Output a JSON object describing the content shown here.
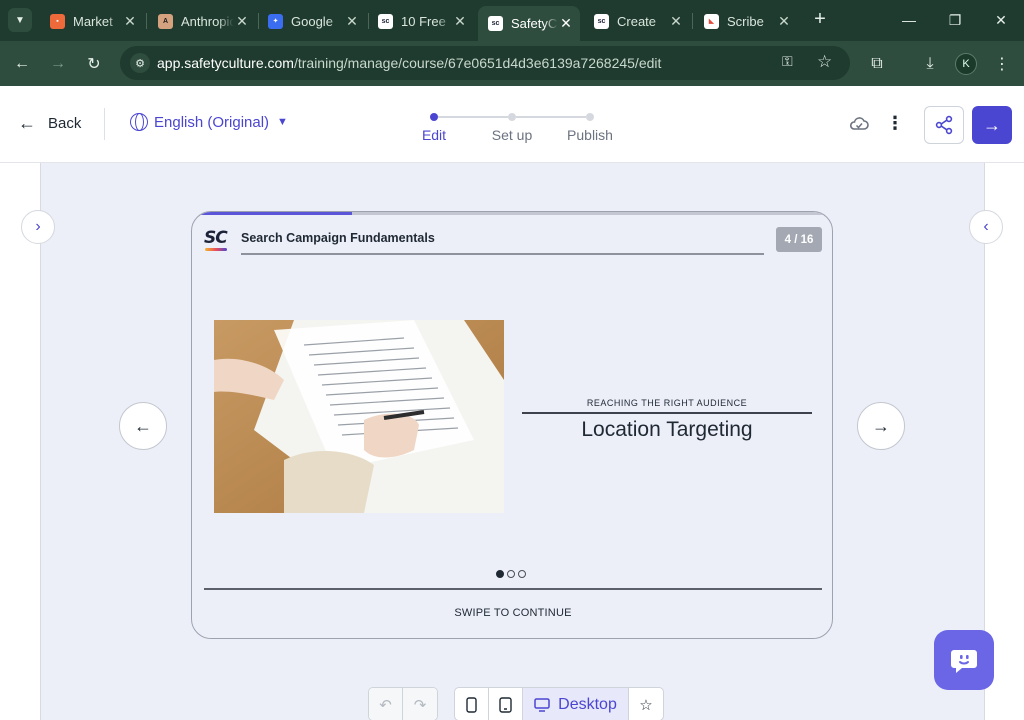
{
  "browser": {
    "tabs": [
      {
        "title": "Market",
        "favicon": "grid-icon",
        "color": "#ef6a3b"
      },
      {
        "title": "Anthropic",
        "favicon": "anthropic-icon",
        "color": "#d4a27f"
      },
      {
        "title": "Google",
        "favicon": "butterfly-icon",
        "color": "#3a6df0"
      },
      {
        "title": "10 Free",
        "favicon": "safetyculture-icon",
        "color": "#ffffff"
      },
      {
        "title": "SafetyCulture",
        "favicon": "safetyculture-icon",
        "color": "#ffffff",
        "active": true
      },
      {
        "title": "Create",
        "favicon": "safetyculture-icon",
        "color": "#ffffff"
      },
      {
        "title": "Scribe",
        "favicon": "scribe-icon",
        "color": "#e34b3c"
      }
    ],
    "url_domain": "app.safetyculture.com",
    "url_path": "/training/manage/course/67e0651d4d3e6139a7268245/edit",
    "profile_initial": "K"
  },
  "header": {
    "back_label": "Back",
    "language": "English (Original)",
    "steps": [
      {
        "label": "Edit",
        "active": true
      },
      {
        "label": "Set up",
        "active": false
      },
      {
        "label": "Publish",
        "active": false
      }
    ]
  },
  "slide": {
    "course_title": "Search Campaign Fundamentals",
    "page_indicator": "4 / 16",
    "progress_fraction": 0.25,
    "eyebrow": "REACHING THE RIGHT AUDIENCE",
    "heading": "Location Targeting",
    "pager_count": 3,
    "pager_active": 0,
    "footer": "SWIPE TO CONTINUE"
  },
  "devices": {
    "desktop_label": "Desktop"
  },
  "colors": {
    "accent": "#4b46d1",
    "stage": "#eceef8",
    "browser": "#2f4d3f"
  }
}
